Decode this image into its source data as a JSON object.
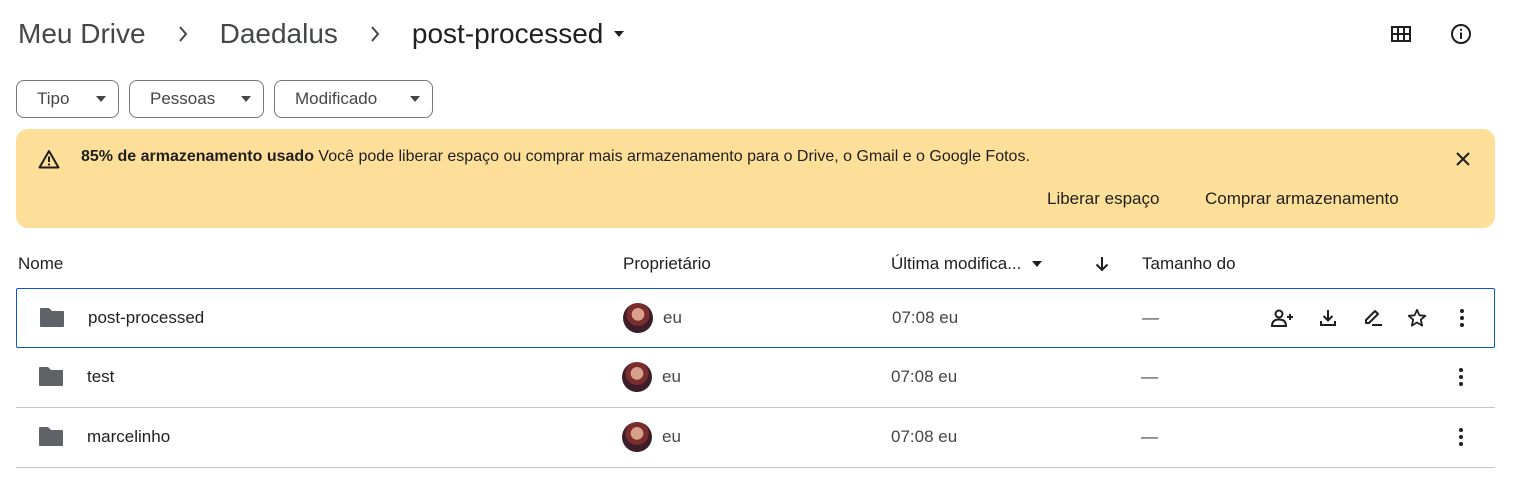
{
  "breadcrumb": {
    "items": [
      "Meu Drive",
      "Daedalus"
    ],
    "current": "post-processed"
  },
  "view_buttons": {
    "grid_icon": "grid-view-icon",
    "info_icon": "info-icon"
  },
  "filters": [
    {
      "label": "Tipo"
    },
    {
      "label": "Pessoas"
    },
    {
      "label": "Modificado"
    }
  ],
  "banner": {
    "title": "85% de armazenamento usado",
    "message": "Você pode liberar espaço ou comprar mais armazenamento para o Drive, o Gmail e o Google Fotos.",
    "free_space": "Liberar espaço",
    "buy_storage": "Comprar armazenamento",
    "background_color": "#fedf99"
  },
  "table": {
    "columns": {
      "name": "Nome",
      "owner": "Proprietário",
      "modified": "Última modifica...",
      "size": "Tamanho do"
    },
    "rows": [
      {
        "name": "post-processed",
        "owner": "eu",
        "modified": "07:08 eu",
        "size": "—",
        "selected": true
      },
      {
        "name": "test",
        "owner": "eu",
        "modified": "07:08 eu",
        "size": "—",
        "selected": false
      },
      {
        "name": "marcelinho",
        "owner": "eu",
        "modified": "07:08 eu",
        "size": "—",
        "selected": false
      }
    ]
  },
  "colors": {
    "accent": "#0b57d0",
    "text": "#1f1f1f",
    "muted": "#444746"
  }
}
